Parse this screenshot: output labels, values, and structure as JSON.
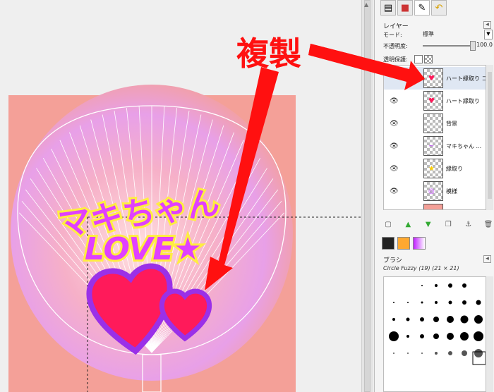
{
  "annotation": {
    "label": "複製"
  },
  "artwork": {
    "line1": "マキちゃん",
    "line2": "LOVE★"
  },
  "panel": {
    "title": "レイヤー",
    "mode_label": "モード:",
    "mode_value": "標準",
    "opacity_label": "不透明度:",
    "opacity_value": "100.0",
    "opacity_level": 1.0,
    "lock_label": "透明保護:",
    "layers": [
      {
        "name": "ハート縁取り コピー",
        "visible": false,
        "selected": true,
        "thumb": "heart-copy"
      },
      {
        "name": "ハート縁取り",
        "visible": true,
        "selected": false,
        "thumb": "heart"
      },
      {
        "name": "背景",
        "visible": true,
        "selected": false,
        "thumb": "empty"
      },
      {
        "name": "マキちゃん ...",
        "visible": true,
        "selected": false,
        "thumb": "text"
      },
      {
        "name": "縁取り",
        "visible": true,
        "selected": false,
        "thumb": "yellow"
      },
      {
        "name": "模様",
        "visible": true,
        "selected": false,
        "thumb": "pattern"
      }
    ],
    "brushes_title": "ブラシ",
    "brush_name": "Circle Fuzzy (19) (21 × 21)"
  },
  "colors": {
    "canvas_bg": "#f4a098",
    "glow": "#e8a0e8",
    "arrow": "#ff1010",
    "heart_fill": "#ff1a5a",
    "heart_stroke": "#9a30e8",
    "text_fill": "#e040ff",
    "text_stroke": "#ffee40"
  }
}
